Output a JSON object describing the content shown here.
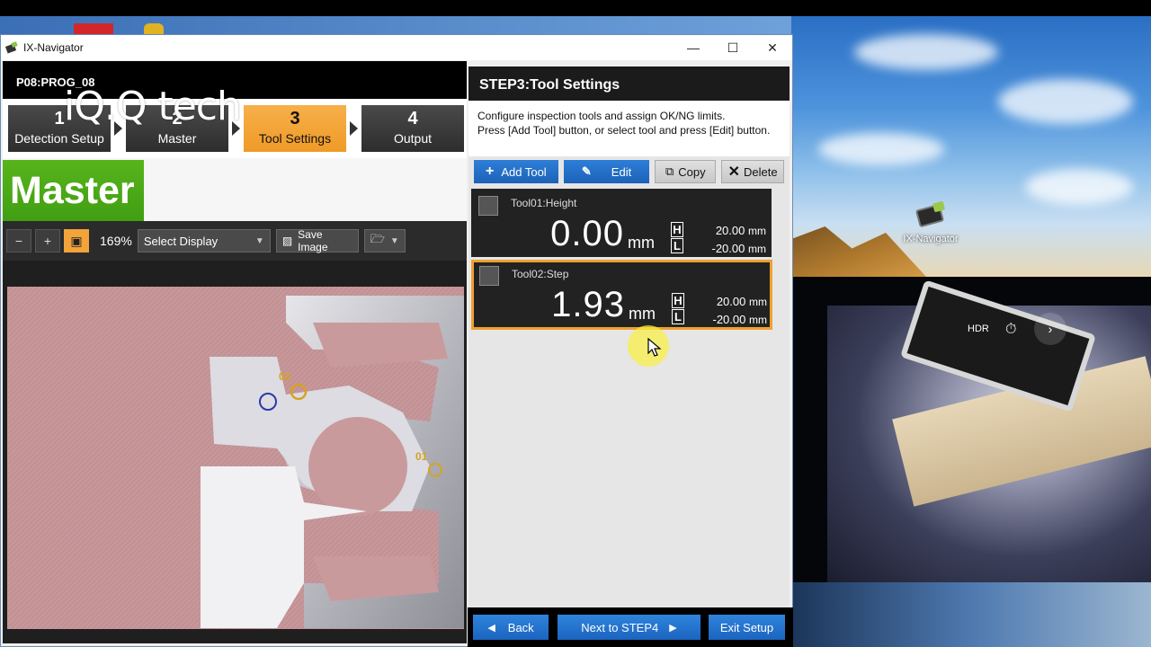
{
  "watermark": "iQ.Q tech",
  "window": {
    "title": "IX-Navigator"
  },
  "program": {
    "name": "P08:PROG_08"
  },
  "steps": [
    {
      "num": "1",
      "label": "Detection Setup"
    },
    {
      "num": "2",
      "label": "Master"
    },
    {
      "num": "3",
      "label": "Tool Settings"
    },
    {
      "num": "4",
      "label": "Output"
    }
  ],
  "master_badge": "Master",
  "view_toolbar": {
    "zoom": "169%",
    "select_display": "Select Display",
    "save_image": "Save Image"
  },
  "image_markers": {
    "marker_a": "02",
    "marker_b": "01"
  },
  "right_panel": {
    "title": "STEP3:Tool Settings",
    "desc_line1": "Configure inspection tools and assign OK/NG limits.",
    "desc_line2": "Press [Add Tool] button, or select tool and press [Edit] button.",
    "add_tool": "Add Tool",
    "edit": "Edit",
    "copy": "Copy",
    "delete": "Delete"
  },
  "tools": [
    {
      "name": "Tool01:Height",
      "value": "0.00",
      "unit": "mm",
      "hi_flag": "H",
      "lo_flag": "L",
      "hi": "20.00",
      "lo": "-20.00",
      "limit_unit": "mm"
    },
    {
      "name": "Tool02:Step",
      "value": "1.93",
      "unit": "mm",
      "hi_flag": "H",
      "lo_flag": "L",
      "hi": "20.00",
      "lo": "-20.00",
      "limit_unit": "mm"
    }
  ],
  "nav": {
    "back": "Back",
    "next": "Next to STEP4",
    "exit": "Exit Setup"
  },
  "desktop": {
    "icon_label": "IX-Navigator"
  }
}
